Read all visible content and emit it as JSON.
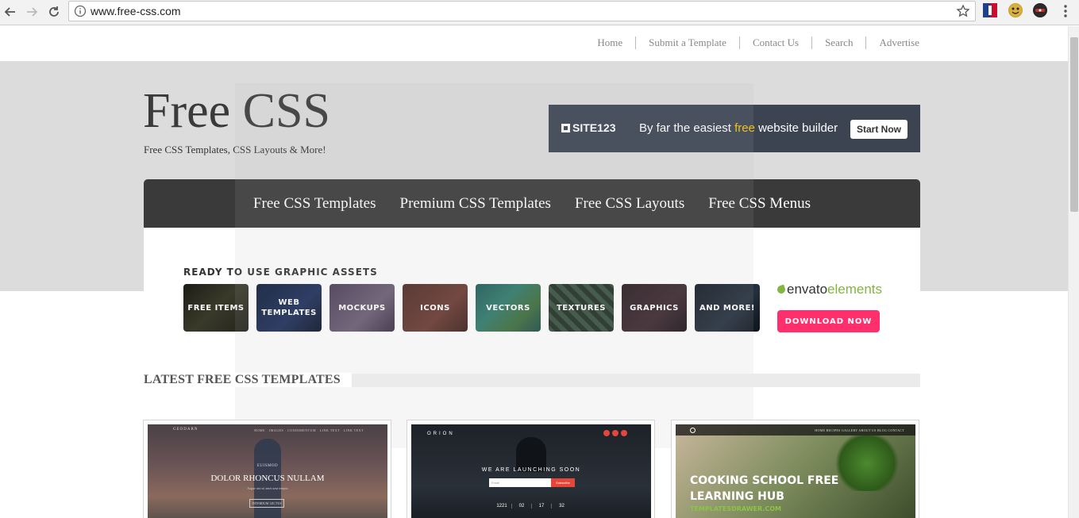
{
  "browser": {
    "url": "www.free-css.com",
    "extensions": [
      {
        "icon": "nba-extension-icon",
        "color": "#1d428a"
      },
      {
        "icon": "emoji-extension-icon",
        "color": "#c8a02a"
      },
      {
        "icon": "bomb-extension-icon",
        "color": "#222222"
      }
    ]
  },
  "topnav": {
    "items": [
      "Home",
      "Submit a Template",
      "Contact Us",
      "Search",
      "Advertise"
    ]
  },
  "header": {
    "title": "Free CSS",
    "tagline": "Free CSS Templates, CSS Layouts & More!"
  },
  "ad": {
    "logo": "SITE123",
    "text_before": "By far the easiest ",
    "text_highlight": "free",
    "text_after": " website builder",
    "button": "Start Now",
    "highlight_color": "#f6c20b"
  },
  "main_nav": {
    "items": [
      "Free CSS Templates",
      "Premium CSS Templates",
      "Free CSS Layouts",
      "Free CSS Menus"
    ]
  },
  "assets": {
    "heading": "READY TO USE GRAPHIC ASSETS",
    "tiles": [
      "FREE ITEMS",
      "WEB TEMPLATES",
      "MOCKUPS",
      "ICONS",
      "VECTORS",
      "TEXTURES",
      "GRAPHICS",
      "AND MORE!"
    ],
    "brand_part1": "envato",
    "brand_part2": "elements",
    "download_button": "DOWNLOAD NOW",
    "button_color": "#ff2f6d"
  },
  "latest": {
    "heading": "LATEST FREE CSS TEMPLATES",
    "cards": [
      {
        "brand": "GEODARN",
        "menu": "HOME · IMAGES · CONDIMENTUM · LINK TEXT · LINK TEXT",
        "small": "EUISMOD",
        "headline": "DOLOR RHONCUS NULLAM",
        "sub": "Augue nisi sit amet urna tempus",
        "button": "INTERDUM LECTUS"
      },
      {
        "brand": "ORION",
        "headline": "WE ARE LAUNCHING SOON",
        "input_placeholder": "Email",
        "button": "Subscribe",
        "counts": [
          "1221",
          "02",
          "17",
          "32"
        ]
      },
      {
        "menu": "HOME  RECIPES  GALLERY  ABOUT US  BLOG  CONTACT",
        "headline_line1": "COOKING SCHOOL FREE",
        "headline_line2": "LEARNING HUB",
        "sub": "TEMPLATESDRAWER.COM"
      }
    ]
  }
}
